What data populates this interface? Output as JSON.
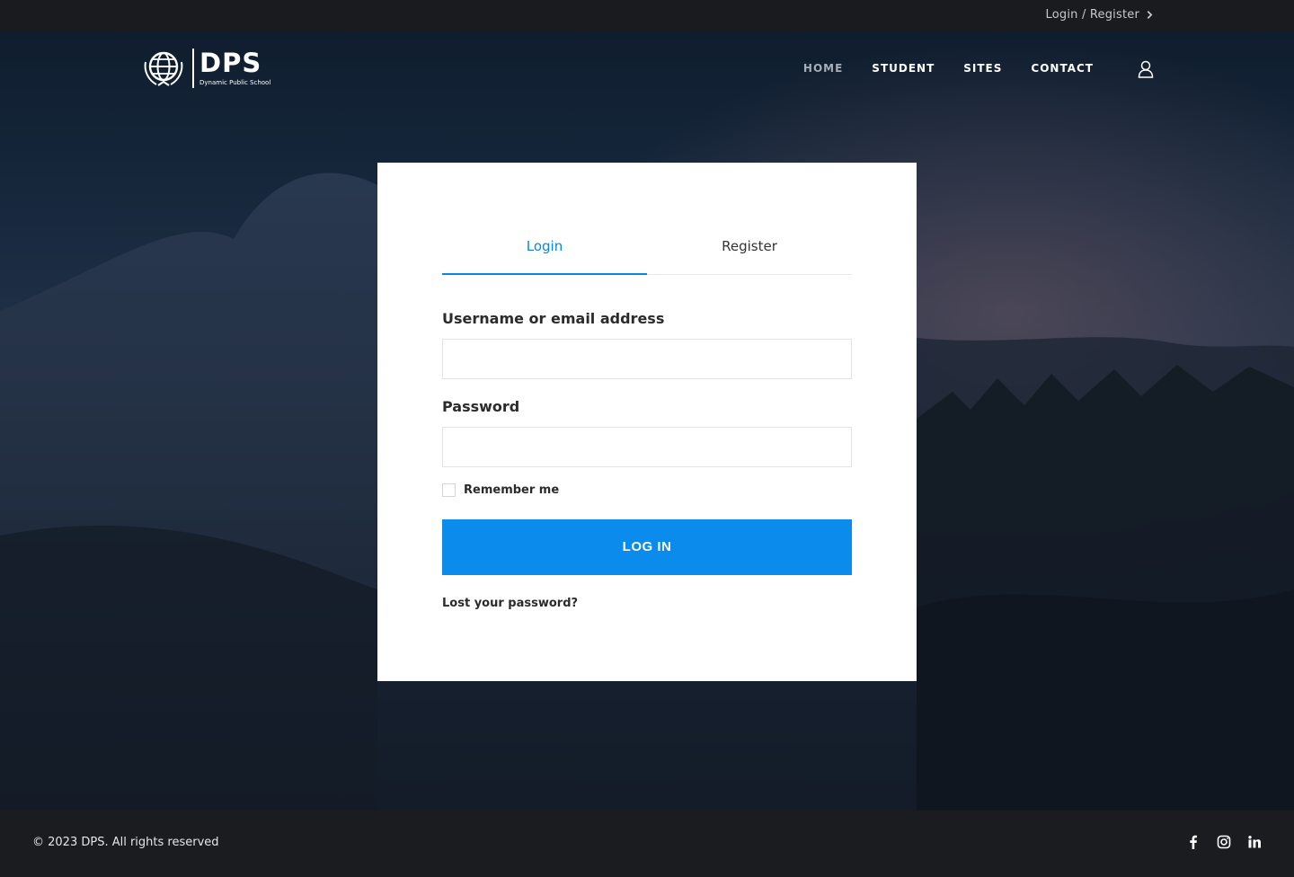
{
  "topbar": {
    "login_register": "Login / Register"
  },
  "logo": {
    "title": "DPS",
    "subtitle": "Dynamic Public School"
  },
  "nav": {
    "items": [
      "HOME",
      "STUDENT",
      "SITES",
      "CONTACT"
    ],
    "active_index": 0
  },
  "form": {
    "tabs": [
      "Login",
      "Register"
    ],
    "active_tab": 0,
    "username_label": "Username or email address",
    "username_value": "",
    "password_label": "Password",
    "password_value": "",
    "remember_label": "Remember me",
    "remember_checked": false,
    "submit_label": "LOG IN",
    "lost_password": "Lost your password?"
  },
  "footer": {
    "copyright": "© 2023 DPS. All rights reserved",
    "socials": [
      "facebook-icon",
      "instagram-icon",
      "linkedin-icon"
    ]
  },
  "colors": {
    "accent": "#0b8beb",
    "tab_active": "#0b86d9",
    "topbar": "#1a1b1e"
  }
}
